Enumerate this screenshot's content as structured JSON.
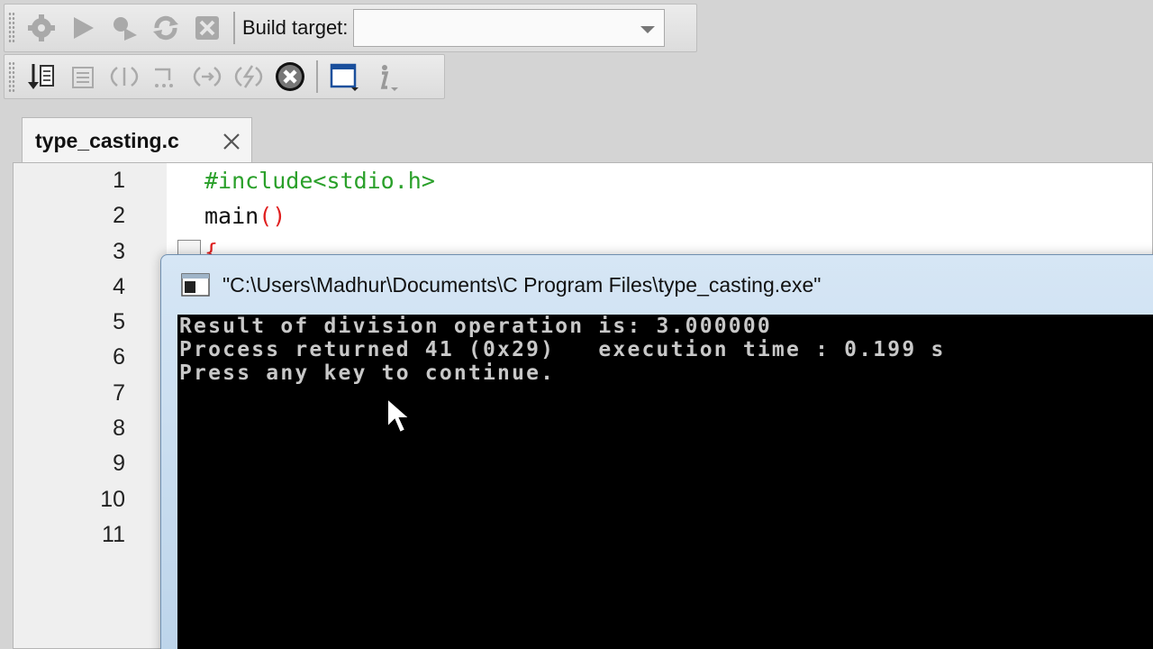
{
  "toolbar_build": {
    "build_target_label": "Build target:",
    "build_target_value": "",
    "buttons": [
      "settings-icon",
      "run-icon",
      "build-icon",
      "rebuild-icon",
      "abort-icon"
    ]
  },
  "toolbar_debug": {
    "buttons": [
      "debug-continue-icon",
      "run-to-cursor-icon",
      "next-line-icon",
      "step-into-icon",
      "step-out-icon",
      "next-instruction-icon",
      "stop-debugger-icon",
      "debug-windows-icon",
      "info-icon"
    ]
  },
  "editor": {
    "tab_label": "type_casting.c",
    "line_numbers": [
      "1",
      "2",
      "3",
      "4",
      "5",
      "6",
      "7",
      "8",
      "9",
      "10",
      "11"
    ],
    "lines": {
      "line1": "#include<stdio.h>",
      "line2_fn": "main",
      "line2_paren": "()",
      "line3_brace": "{"
    }
  },
  "console": {
    "title": "\"C:\\Users\\Madhur\\Documents\\C Program Files\\type_casting.exe\"",
    "output": [
      "Result of division operation is: 3.000000",
      "Process returned 41 (0x29)   execution time : 0.199 s",
      "Press any key to continue."
    ]
  },
  "colors": {
    "preprocessor": "#2aa02a",
    "paren": "#e02020",
    "console_bg": "#000000",
    "console_text": "#c8c8c8"
  }
}
